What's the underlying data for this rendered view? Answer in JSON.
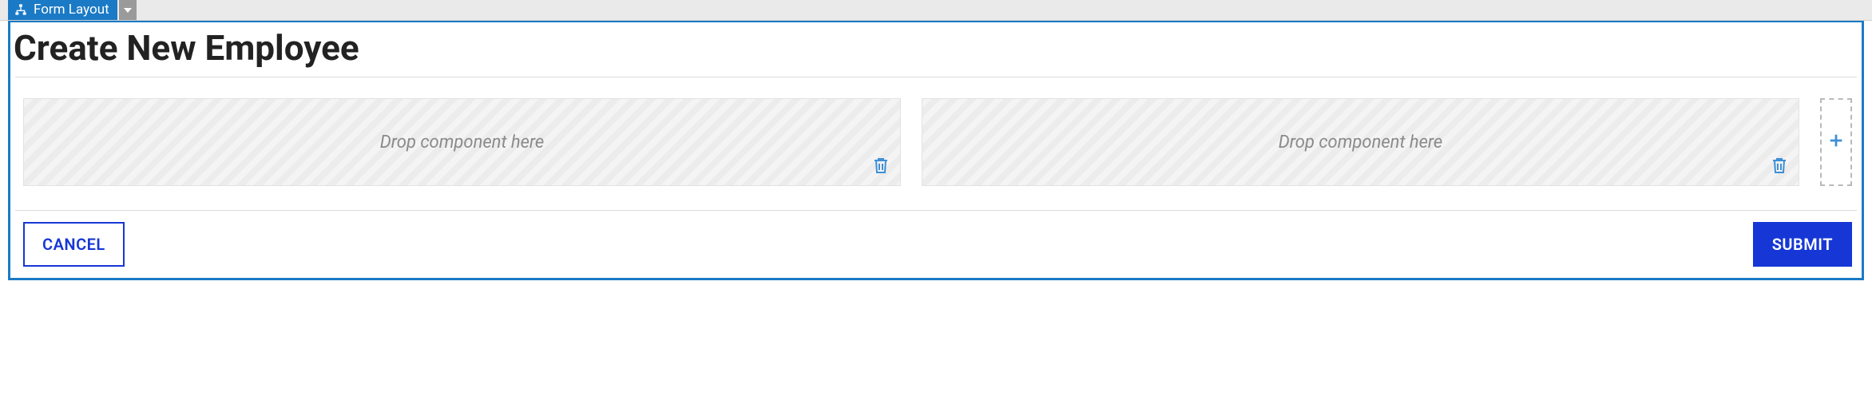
{
  "header": {
    "tab_label": "Form Layout"
  },
  "form": {
    "title": "Create New Employee",
    "dropzones": [
      {
        "placeholder": "Drop component here"
      },
      {
        "placeholder": "Drop component here"
      }
    ],
    "buttons": {
      "cancel": "CANCEL",
      "submit": "SUBMIT"
    }
  }
}
